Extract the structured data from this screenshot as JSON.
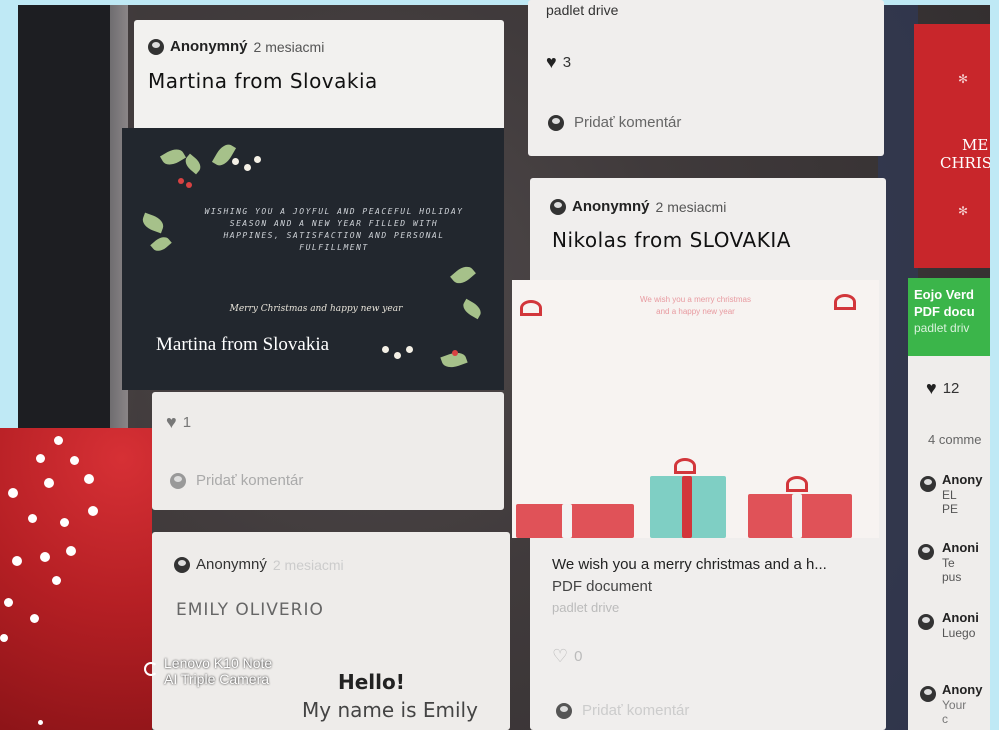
{
  "posts": {
    "martina": {
      "author": "Anonymný",
      "time": "2 mesiacmi",
      "title": "Martina from Slovakia",
      "likes": "1",
      "comment_placeholder": "Pridať komentár",
      "card_text_main": "WISHING YOU A JOYFUL AND PEACEFUL HOLIDAY SEASON AND A NEW YEAR FILLED WITH HAPPINES, SATISFACTION AND PERSONAL FULFILLMENT",
      "card_text_merry": "Merry Christmas and happy new year",
      "card_signature": "Martina from Slovakia"
    },
    "top_middle": {
      "link_text": "padlet drive",
      "likes": "3",
      "comment_placeholder": "Pridať komentár"
    },
    "nikolas": {
      "author": "Anonymný",
      "time": "2 mesiacmi",
      "title": "Nikolas from SLOVAKIA",
      "card_line1": "We wish you a merry christmas",
      "card_line2": "and a happy new year",
      "attachment_title": "We wish you a merry christmas and a h...",
      "attachment_type": "PDF document",
      "attachment_source": "padlet drive",
      "likes": "0",
      "comment_placeholder": "Pridať komentár"
    },
    "emily": {
      "author": "Anonymný",
      "time": "2 mesiacmi",
      "title": "EMILY OLIVERIO",
      "hello": "Hello!",
      "name_line": "My name is Emily"
    },
    "right_column": {
      "merry_card_line1": "ME",
      "merry_card_line2": "CHRIS",
      "attachment_title": "Eojo Verd",
      "attachment_type": "PDF docu",
      "attachment_source": "padlet driv",
      "likes": "12",
      "comments_count": "4 comme",
      "comments": [
        {
          "author": "Anony",
          "text": "EL PE"
        },
        {
          "author": "Anoni",
          "text": "Te pus"
        },
        {
          "author": "Anoni",
          "text": "Luego"
        },
        {
          "author": "Anony",
          "text": "Your c"
        }
      ]
    }
  },
  "camera_watermark": {
    "line1": "Lenovo K10 Note",
    "line2": "AI Triple Camera"
  },
  "colors": {
    "accent_red": "#c8262b",
    "accent_green": "#3bb54a",
    "card_dark": "#22272e"
  }
}
